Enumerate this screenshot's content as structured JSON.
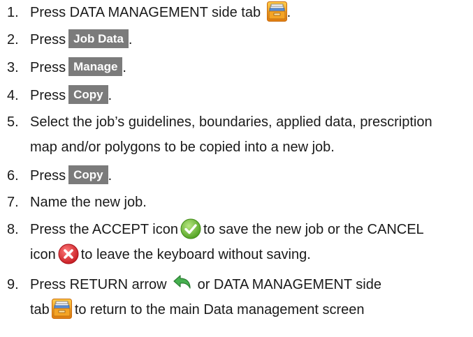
{
  "steps": [
    {
      "number": "1.",
      "text_a": "Press DATA MANAGEMENT side tab",
      "text_b": "."
    },
    {
      "number": "2.",
      "text_a": "Press",
      "button": "Job Data",
      "text_b": "."
    },
    {
      "number": "3.",
      "text_a": "Press",
      "button": "Manage",
      "text_b": "."
    },
    {
      "number": "4.",
      "text_a": "Press",
      "button": "Copy",
      "text_b": "."
    },
    {
      "number": "5.",
      "line1": "Select the job’s guidelines, boundaries, applied data, prescription",
      "line2": "map and/or polygons to be copied into a new job."
    },
    {
      "number": "6.",
      "text_a": "Press",
      "button": "Copy",
      "text_b": "."
    },
    {
      "number": "7.",
      "text_a": "Name the new job."
    },
    {
      "number": "8.",
      "line1_a": "Press the ACCEPT icon",
      "line1_b": "to save the new job or the CANCEL",
      "line2_a": "icon",
      "line2_b": "to leave the keyboard without saving."
    },
    {
      "number": "9.",
      "line1_a": "Press RETURN arrow",
      "line1_b": "or DATA MANAGEMENT side",
      "line2_a": "tab",
      "line2_b": "to return to the main Data management screen"
    }
  ],
  "icons": {
    "data_management": "data-management-tab-icon",
    "accept": "accept-checkmark-icon",
    "cancel": "cancel-x-icon",
    "return": "return-arrow-icon"
  },
  "colors": {
    "button_bg": "#7b7b7b",
    "button_text": "#ffffff",
    "accept_green": "#5fb52c",
    "cancel_red": "#d8242a",
    "return_green": "#3fa84a",
    "tab_orange": "#e8901a"
  }
}
